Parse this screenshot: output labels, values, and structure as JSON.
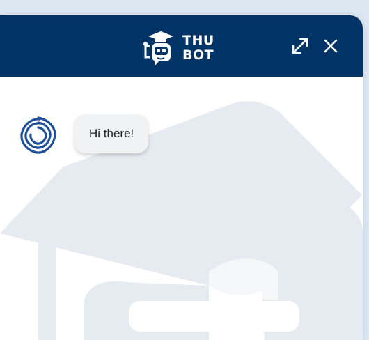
{
  "header": {
    "brand_line1": "THU",
    "brand_line2": "BOT",
    "logo_icon": "graduation-robot-icon",
    "expand_icon": "expand-icon",
    "close_icon": "close-icon"
  },
  "colors": {
    "header_bg": "#003366",
    "page_bg": "#dde7f2",
    "bubble_bg": "#f1f2f4",
    "watermark": "#e6ebf1"
  },
  "messages": [
    {
      "sender": "bot",
      "avatar_icon": "spiral-logo-icon",
      "text": "Hi there!"
    }
  ],
  "watermark_icon": "graduation-cap-document-icon"
}
